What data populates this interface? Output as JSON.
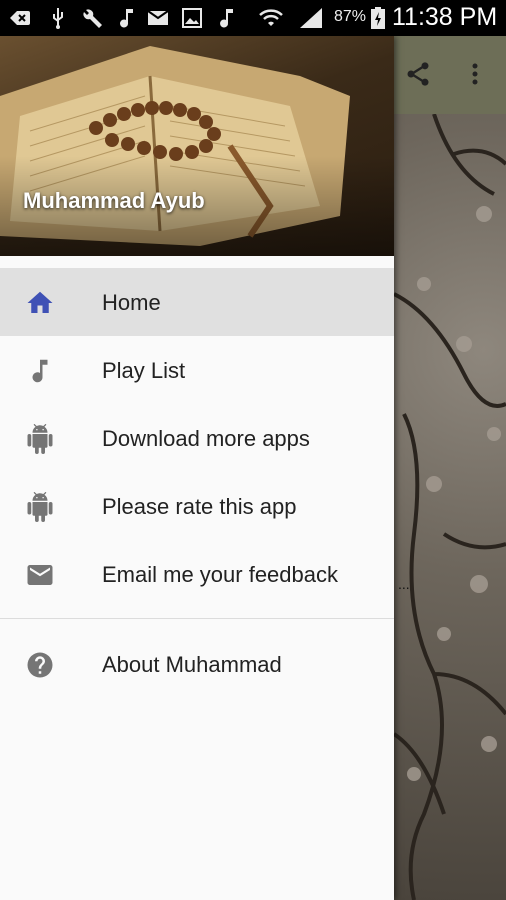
{
  "status_bar": {
    "battery_percent": "87%",
    "time": "11:38 PM"
  },
  "drawer": {
    "header_title": "Muhammad Ayub",
    "items": [
      {
        "label": "Home",
        "icon": "home-icon",
        "active": true
      },
      {
        "label": "Play List",
        "icon": "music-note-icon"
      },
      {
        "label": "Download more apps",
        "icon": "android-icon"
      },
      {
        "label": "Please rate this app",
        "icon": "android-icon"
      },
      {
        "label": "Email me your feedback",
        "icon": "email-icon"
      },
      {
        "label": "About Muhammad",
        "icon": "help-circle-icon"
      }
    ],
    "accent_color": "#3f51b5",
    "icon_color": "#757575"
  },
  "background": {
    "toolbar_color": "#6d6e57",
    "hint_text": "..."
  }
}
